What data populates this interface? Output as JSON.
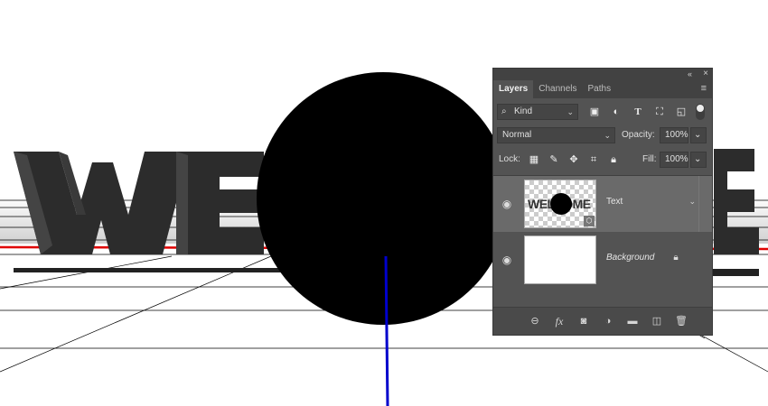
{
  "canvas": {
    "word": "WELCOME",
    "visible_letters": [
      "W",
      "E",
      "E"
    ],
    "colors": {
      "background": "#ffffff",
      "letters": "#3a3a3a",
      "circle": "#000000",
      "axis_line": "#0000cc",
      "red_line": "#e00000",
      "grid": "#000000"
    }
  },
  "panel": {
    "collapse_icon": "«",
    "close_icon": "×",
    "tabs": [
      "Layers",
      "Channels",
      "Paths"
    ],
    "active_tab": "Layers",
    "menu_icon": "≡",
    "filter": {
      "kind_label": "Kind",
      "icons": [
        "image-filter-icon",
        "adjustment-filter-icon",
        "type-filter-icon",
        "shape-filter-icon",
        "smart-object-filter-icon",
        "filter-toggle-icon"
      ]
    },
    "blend_mode": "Normal",
    "opacity_label": "Opacity:",
    "opacity_value": "100%",
    "lock_label": "Lock:",
    "fill_label": "Fill:",
    "fill_value": "100%",
    "layers": [
      {
        "name": "Text",
        "type": "3d",
        "selected": true,
        "thumb_text": "WELCOME"
      },
      {
        "name": "Background",
        "type": "background",
        "selected": false,
        "locked": true
      }
    ],
    "bottom_icons": [
      "link-icon",
      "fx-icon",
      "mask-icon",
      "adjustment-icon",
      "folder-icon",
      "new-layer-icon",
      "trash-icon"
    ],
    "fx_label": "fx"
  }
}
